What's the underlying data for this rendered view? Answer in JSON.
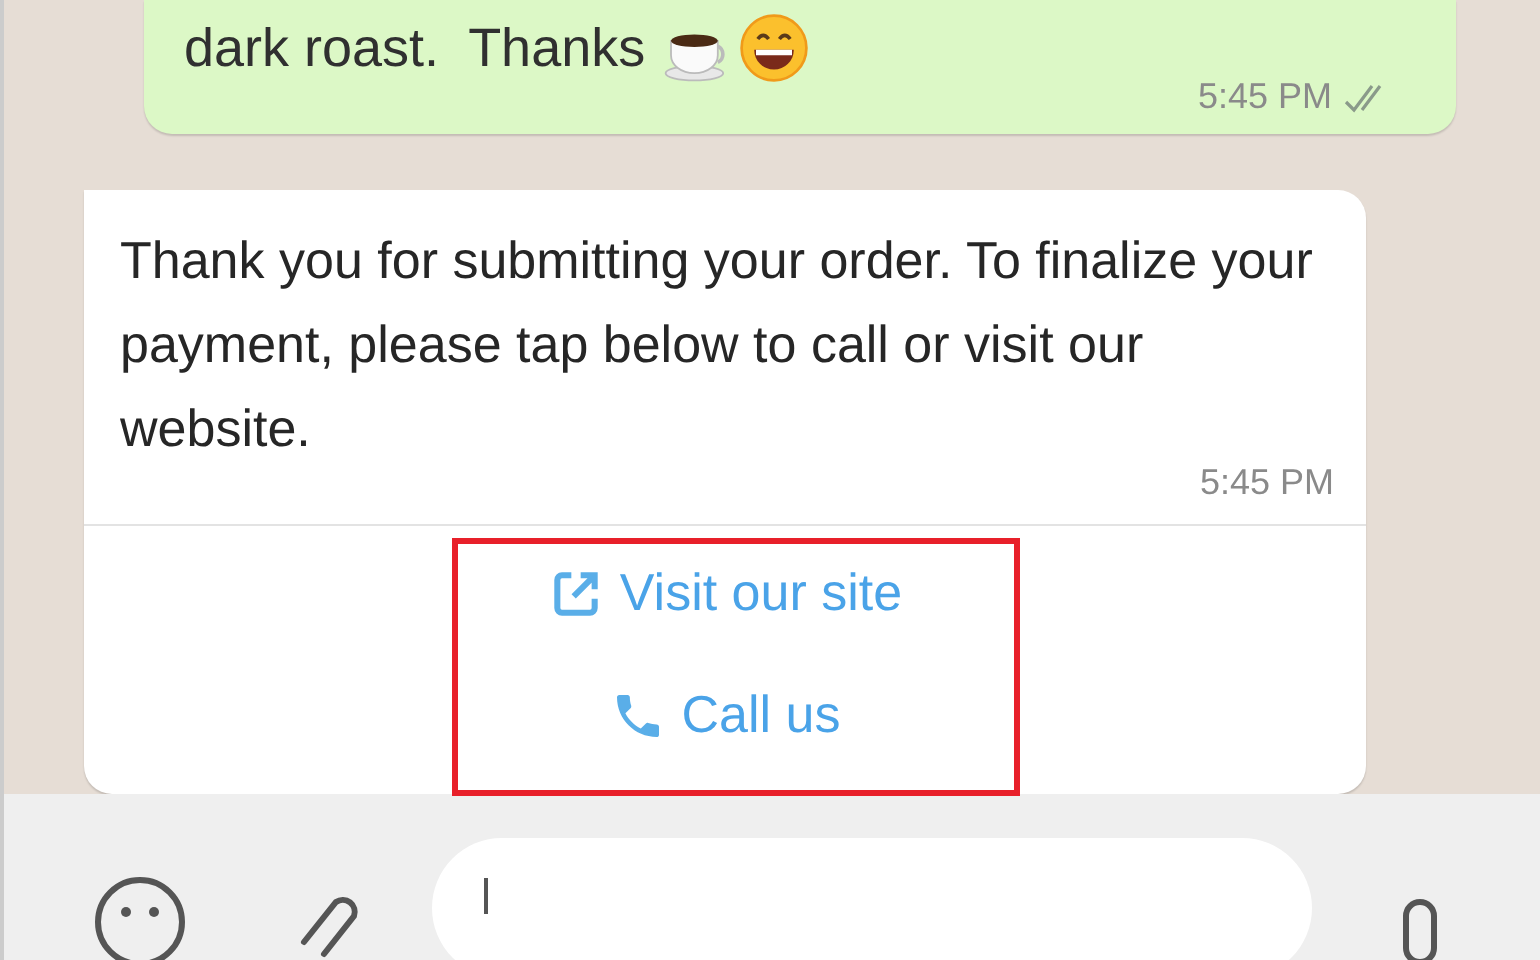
{
  "messages": [
    {
      "kind": "outgoing",
      "text": "dark roast.  Thanks",
      "time": "5:45 PM",
      "read": true
    },
    {
      "kind": "incoming",
      "text": "Thank you for submitting your order. To finalize your payment, please tap below to call or visit our website.",
      "time": "5:45 PM",
      "buttons": [
        {
          "kind": "link",
          "label": "Visit our site"
        },
        {
          "kind": "phone",
          "label": "Call us"
        }
      ],
      "highlighted": true
    }
  ]
}
